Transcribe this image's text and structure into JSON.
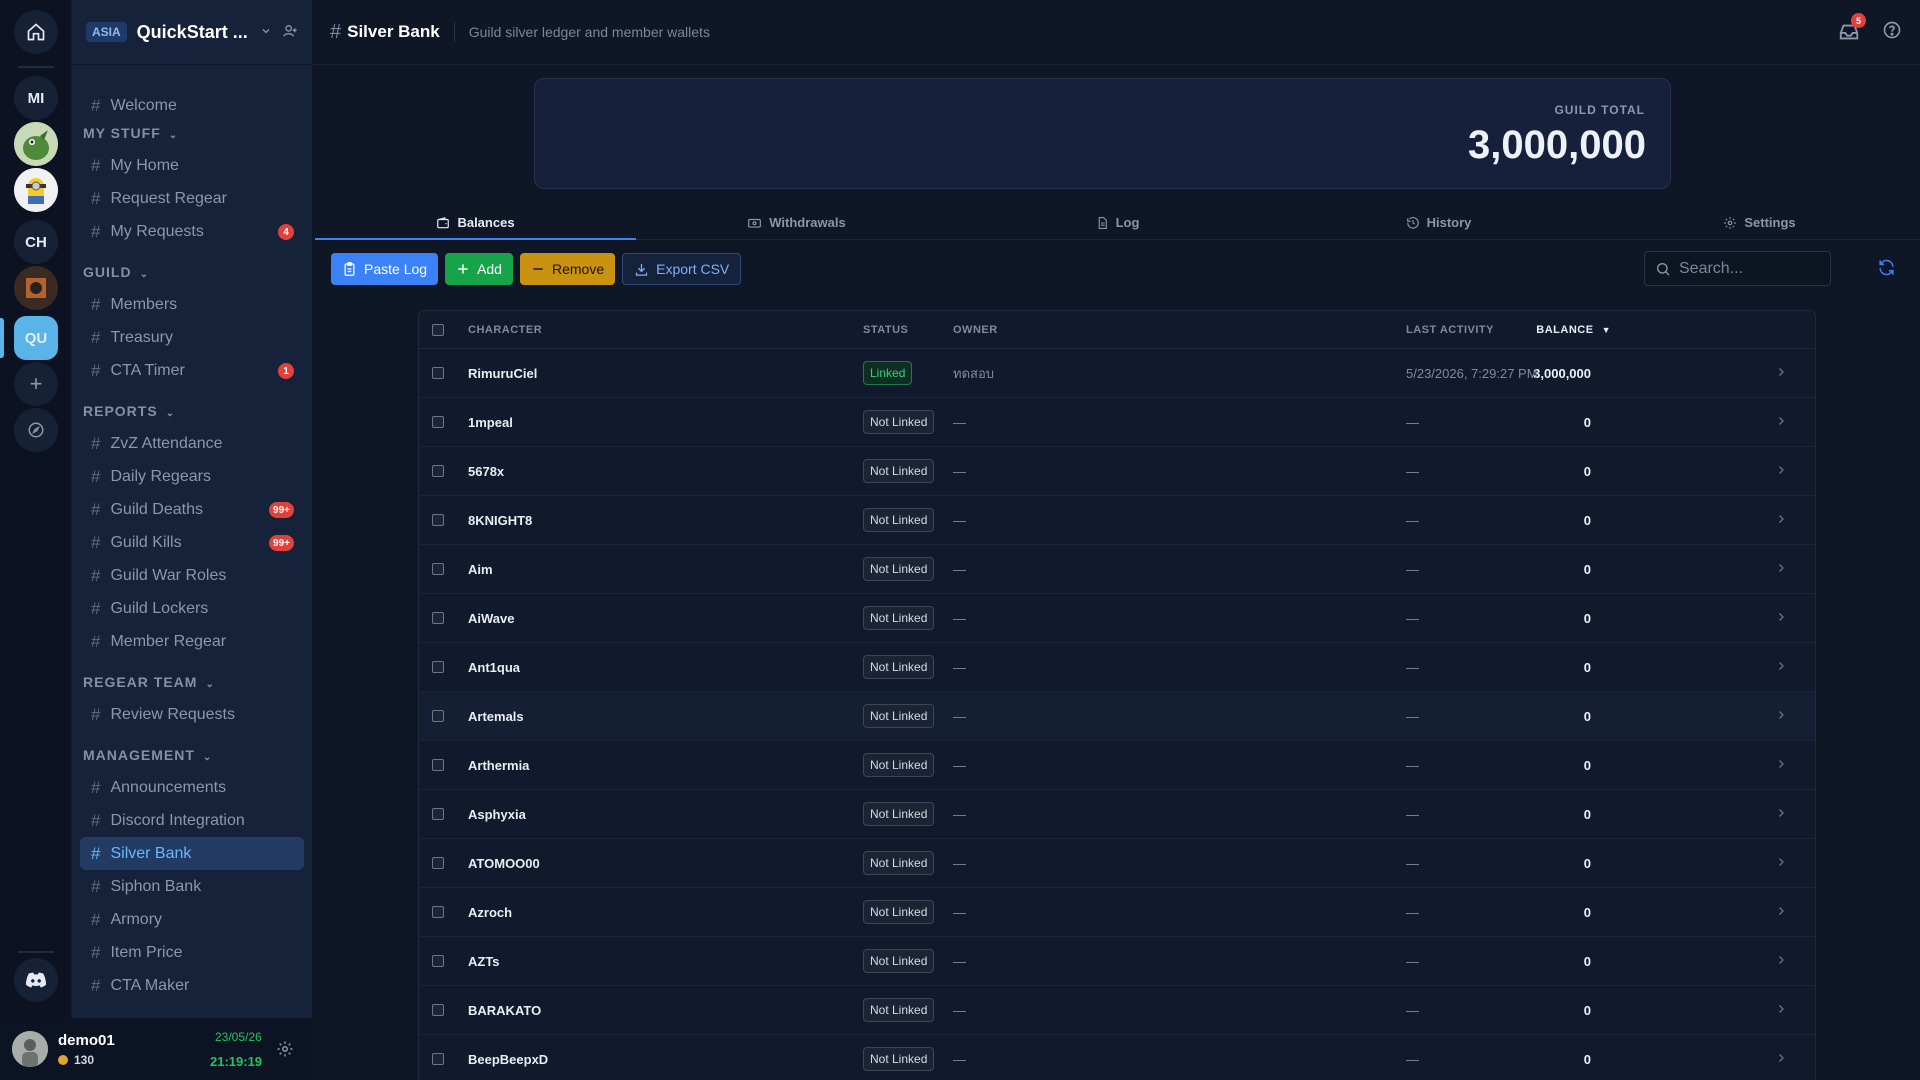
{
  "rail": {
    "items": [
      {
        "label": "MI"
      },
      {
        "label": "CH"
      },
      {
        "label": "QU"
      }
    ],
    "add_label": "+"
  },
  "server": {
    "region": "ASIA",
    "name": "QuickStart ..."
  },
  "sidebar": {
    "welcome": "Welcome",
    "categories": [
      {
        "name": "MY STUFF",
        "channels": [
          {
            "label": "My Home"
          },
          {
            "label": "Request Regear"
          },
          {
            "label": "My Requests",
            "badge": "4"
          }
        ]
      },
      {
        "name": "GUILD",
        "channels": [
          {
            "label": "Members"
          },
          {
            "label": "Treasury"
          },
          {
            "label": "CTA Timer",
            "badge": "1"
          }
        ]
      },
      {
        "name": "REPORTS",
        "channels": [
          {
            "label": "ZvZ Attendance"
          },
          {
            "label": "Daily Regears"
          },
          {
            "label": "Guild Deaths",
            "badge": "99+"
          },
          {
            "label": "Guild Kills",
            "badge": "99+"
          },
          {
            "label": "Guild War Roles"
          },
          {
            "label": "Guild Lockers"
          },
          {
            "label": "Member Regear"
          }
        ]
      },
      {
        "name": "REGEAR TEAM",
        "channels": [
          {
            "label": "Review Requests"
          }
        ]
      },
      {
        "name": "MANAGEMENT",
        "channels": [
          {
            "label": "Announcements"
          },
          {
            "label": "Discord Integration"
          },
          {
            "label": "Silver Bank",
            "active": true
          },
          {
            "label": "Siphon Bank"
          },
          {
            "label": "Armory"
          },
          {
            "label": "Item Price"
          },
          {
            "label": "CTA Maker"
          }
        ]
      }
    ]
  },
  "user": {
    "name": "demo01",
    "coins": "130",
    "date": "23/05/26",
    "time": "21:19:19"
  },
  "header": {
    "title": "Silver Bank",
    "description": "Guild silver ledger and member wallets",
    "notification_count": "5"
  },
  "summary": {
    "label": "GUILD TOTAL",
    "value": "3,000,000"
  },
  "tabs": [
    {
      "label": "Balances",
      "icon": "wallet-icon",
      "active": true
    },
    {
      "label": "Withdrawals",
      "icon": "card-icon"
    },
    {
      "label": "Log",
      "icon": "document-icon"
    },
    {
      "label": "History",
      "icon": "history-icon"
    },
    {
      "label": "Settings",
      "icon": "gear-icon"
    }
  ],
  "toolbar": {
    "paste_log": "Paste Log",
    "add": "Add",
    "remove": "Remove",
    "export_csv": "Export CSV"
  },
  "search": {
    "placeholder": "Search..."
  },
  "table": {
    "columns": {
      "character": "CHARACTER",
      "status": "STATUS",
      "owner": "OWNER",
      "balance": "BALANCE",
      "sort_indicator": "▼",
      "last_activity": "LAST ACTIVITY"
    },
    "rows": [
      {
        "character": "RimuruCiel",
        "status": "Linked",
        "owner": "ทดสอบ",
        "balance": "3,000,000",
        "last_activity": "5/23/2026, 7:29:27 PM"
      },
      {
        "character": "1mpeal",
        "status": "Not Linked",
        "owner": "—",
        "balance": "0",
        "last_activity": "—"
      },
      {
        "character": "5678x",
        "status": "Not Linked",
        "owner": "—",
        "balance": "0",
        "last_activity": "—"
      },
      {
        "character": "8KNIGHT8",
        "status": "Not Linked",
        "owner": "—",
        "balance": "0",
        "last_activity": "—"
      },
      {
        "character": "Aim",
        "status": "Not Linked",
        "owner": "—",
        "balance": "0",
        "last_activity": "—"
      },
      {
        "character": "AiWave",
        "status": "Not Linked",
        "owner": "—",
        "balance": "0",
        "last_activity": "—"
      },
      {
        "character": "Ant1qua",
        "status": "Not Linked",
        "owner": "—",
        "balance": "0",
        "last_activity": "—"
      },
      {
        "character": "Artemals",
        "status": "Not Linked",
        "owner": "—",
        "balance": "0",
        "last_activity": "—"
      },
      {
        "character": "Arthermia",
        "status": "Not Linked",
        "owner": "—",
        "balance": "0",
        "last_activity": "—"
      },
      {
        "character": "Asphyxia",
        "status": "Not Linked",
        "owner": "—",
        "balance": "0",
        "last_activity": "—"
      },
      {
        "character": "ATOMOO00",
        "status": "Not Linked",
        "owner": "—",
        "balance": "0",
        "last_activity": "—"
      },
      {
        "character": "Azroch",
        "status": "Not Linked",
        "owner": "—",
        "balance": "0",
        "last_activity": "—"
      },
      {
        "character": "AZTs",
        "status": "Not Linked",
        "owner": "—",
        "balance": "0",
        "last_activity": "—"
      },
      {
        "character": "BARAKATO",
        "status": "Not Linked",
        "owner": "—",
        "balance": "0",
        "last_activity": "—"
      },
      {
        "character": "BeepBeepxD",
        "status": "Not Linked",
        "owner": "—",
        "balance": "0",
        "last_activity": "—"
      }
    ]
  }
}
